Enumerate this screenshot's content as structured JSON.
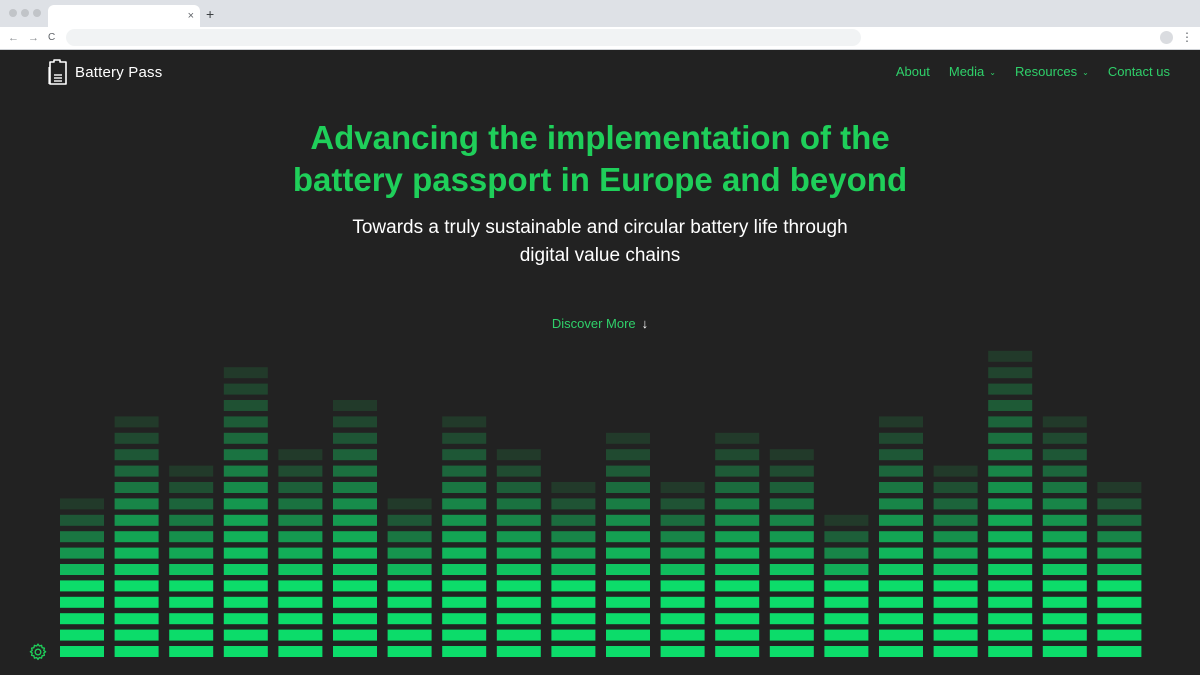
{
  "browser": {
    "tab_close": "×",
    "new_tab": "+",
    "back": "←",
    "forward": "→",
    "reload": "C",
    "menu": "⋮"
  },
  "header": {
    "logo_text": "Battery Pass",
    "nav": [
      {
        "label": "About",
        "dropdown": false
      },
      {
        "label": "Media",
        "dropdown": true
      },
      {
        "label": "Resources",
        "dropdown": true
      },
      {
        "label": "Contact us",
        "dropdown": false
      }
    ],
    "chevron": "⌄"
  },
  "hero": {
    "title_line1": "Advancing the implementation of the",
    "title_line2": "battery passport in Europe and beyond",
    "subtitle_line1": "Towards a truly sustainable and circular battery life through",
    "subtitle_line2": "digital value chains",
    "cta_label": "Discover More",
    "cta_arrow": "↓"
  },
  "equalizer": {
    "column_heights": [
      10,
      15,
      12,
      18,
      13,
      16,
      10,
      15,
      13,
      11,
      14,
      11,
      14,
      13,
      9,
      15,
      12,
      19,
      15,
      11
    ]
  },
  "colors": {
    "background": "#222222",
    "accent": "#1fcf5a",
    "bar_bright": "#0cdc6a",
    "bar_dim": "#223a2a"
  },
  "icons": {
    "settings": "gear-icon",
    "logo": "battery-passport-icon"
  }
}
